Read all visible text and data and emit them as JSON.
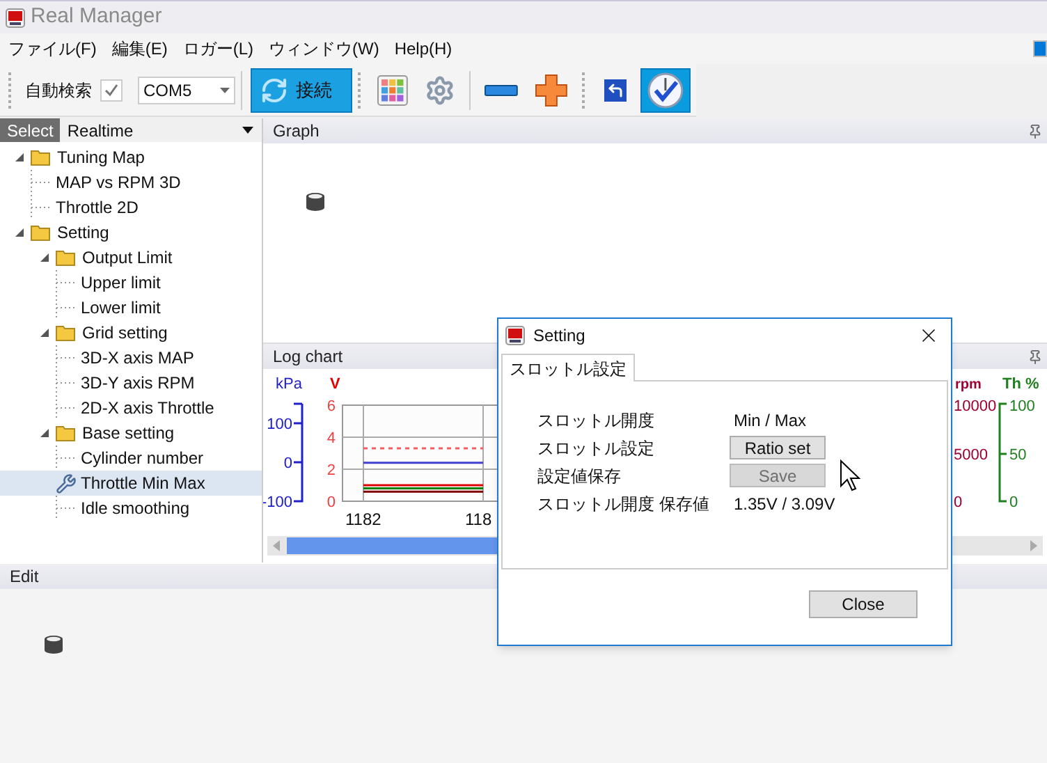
{
  "window": {
    "title": "Real Manager"
  },
  "menu": [
    "ファイル(F)",
    "編集(E)",
    "ロガー(L)",
    "ウィンドウ(W)",
    "Help(H)"
  ],
  "toolbar": {
    "auto_search": {
      "label": "自動検索",
      "checked": true
    },
    "port": {
      "value": "COM5"
    },
    "connect_button": {
      "label": "接続"
    },
    "tools": [
      {
        "kind": "grid",
        "selected": false
      },
      {
        "kind": "gear",
        "selected": false
      },
      {
        "kind": "minus",
        "selected": false
      },
      {
        "kind": "plus",
        "selected": false
      },
      {
        "kind": "back",
        "selected": false
      },
      {
        "kind": "clock",
        "selected": true
      }
    ]
  },
  "left_panel": {
    "label": "Select",
    "value": "Realtime"
  },
  "tree": {
    "items": [
      {
        "label": "Tuning Map",
        "kind": "folder",
        "expanded": true,
        "selected": false,
        "children": [
          {
            "label": "MAP vs RPM 3D",
            "kind": "leaf",
            "selected": false
          },
          {
            "label": "Throttle 2D",
            "kind": "leaf",
            "selected": false
          }
        ]
      },
      {
        "label": "Setting",
        "kind": "folder",
        "expanded": true,
        "selected": false,
        "children": [
          {
            "label": "Output Limit",
            "kind": "folder",
            "expanded": true,
            "selected": false,
            "children": [
              {
                "label": "Upper limit",
                "kind": "leaf",
                "selected": false
              },
              {
                "label": "Lower limit",
                "kind": "leaf",
                "selected": false
              }
            ]
          },
          {
            "label": "Grid setting",
            "kind": "folder",
            "expanded": true,
            "selected": false,
            "children": [
              {
                "label": "3D-X axis MAP",
                "kind": "leaf",
                "selected": false
              },
              {
                "label": "3D-Y axis RPM",
                "kind": "leaf",
                "selected": false
              },
              {
                "label": "2D-X axis Throttle",
                "kind": "leaf",
                "selected": false
              }
            ]
          },
          {
            "label": "Base setting",
            "kind": "folder",
            "expanded": true,
            "selected": false,
            "children": [
              {
                "label": "Cylinder number",
                "kind": "leaf",
                "selected": false
              },
              {
                "label": "Throttle Min Max",
                "kind": "tool",
                "selected": true
              },
              {
                "label": "Idle smoothing",
                "kind": "leaf",
                "selected": false
              }
            ]
          }
        ]
      }
    ]
  },
  "graph_panel": {
    "title": "Graph"
  },
  "log_chart": {
    "title": "Log chart",
    "extra_axes": [
      {
        "label": "kPa",
        "ticks": [
          "100",
          "0",
          "-100"
        ],
        "color": "#2020c8"
      },
      {
        "label": "rpm",
        "ticks": [
          "10000",
          "5000",
          "0"
        ],
        "color": "#a00030"
      },
      {
        "label": "Th %",
        "ticks": [
          "100",
          "50",
          "0"
        ],
        "color": "#208020"
      }
    ],
    "chart_data": {
      "type": "line",
      "ylabel": "V",
      "ylim": [
        0,
        6
      ],
      "yticks": [
        0,
        2,
        4,
        6
      ],
      "grid": true,
      "categories": [
        "1182",
        "118"
      ],
      "series": [
        {
          "color": "#f06060",
          "line_style": "dashed",
          "values": [
            3.3,
            3.3
          ]
        },
        {
          "color": "#4040d0",
          "line_style": "solid",
          "values": [
            2.4,
            2.4
          ]
        },
        {
          "color": "#e00000",
          "line_style": "solid",
          "values": [
            1,
            1
          ]
        },
        {
          "color": "#008000",
          "line_style": "solid",
          "values": [
            0.8,
            0.8
          ]
        },
        {
          "color": "#800000",
          "line_style": "solid",
          "values": [
            0.6,
            0.6
          ]
        }
      ]
    }
  },
  "edit_panel": {
    "title": "Edit"
  },
  "dialog": {
    "title": "Setting",
    "tabs": [
      {
        "label": "スロットル設定",
        "selected": true
      }
    ],
    "rows": [
      {
        "label": "スロットル開度",
        "kind": "text",
        "value": "Min / Max",
        "disabled": false
      },
      {
        "label": "スロットル設定",
        "kind": "button",
        "value": "Ratio set",
        "disabled": false
      },
      {
        "label": "設定値保存",
        "kind": "button",
        "value": "Save",
        "disabled": true
      },
      {
        "label": "スロットル開度 保存値",
        "kind": "text",
        "value": "1.35V / 3.09V",
        "disabled": false
      }
    ],
    "close_button": {
      "label": "Close"
    }
  }
}
